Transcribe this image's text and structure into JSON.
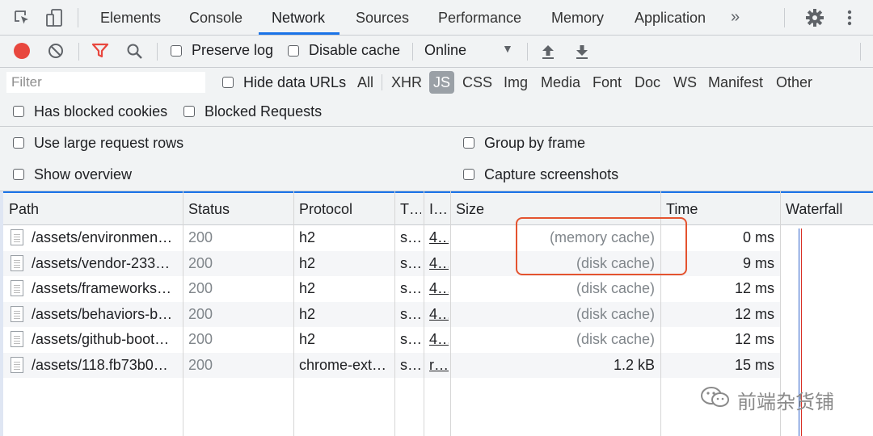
{
  "tabs": [
    "Elements",
    "Console",
    "Network",
    "Sources",
    "Performance",
    "Memory",
    "Application"
  ],
  "active_tab": "Network",
  "toolbar": {
    "preserve_log": "Preserve log",
    "disable_cache": "Disable cache",
    "throttle": "Online",
    "colors": {
      "record": "#e8473e",
      "filter": "#e8473e"
    }
  },
  "filter": {
    "placeholder": "Filter",
    "hide_data_urls": "Hide data URLs",
    "types": [
      "All",
      "XHR",
      "JS",
      "CSS",
      "Img",
      "Media",
      "Font",
      "Doc",
      "WS",
      "Manifest",
      "Other"
    ],
    "active_type": "JS",
    "has_blocked_cookies": "Has blocked cookies",
    "blocked_requests": "Blocked Requests"
  },
  "settings": {
    "large_rows": "Use large request rows",
    "group_by_frame": "Group by frame",
    "show_overview": "Show overview",
    "capture_screenshots": "Capture screenshots"
  },
  "columns": [
    "Path",
    "Status",
    "Protocol",
    "T…",
    "I…",
    "Size",
    "Time",
    "Waterfall"
  ],
  "rows": [
    {
      "path": "/assets/environmen…",
      "status": "200",
      "protocol": "h2",
      "type": "s…",
      "initiator": "4…",
      "size": "(memory cache)",
      "time": "0 ms"
    },
    {
      "path": "/assets/vendor-233…",
      "status": "200",
      "protocol": "h2",
      "type": "s…",
      "initiator": "4…",
      "size": "(disk cache)",
      "time": "9 ms"
    },
    {
      "path": "/assets/frameworks…",
      "status": "200",
      "protocol": "h2",
      "type": "s…",
      "initiator": "4…",
      "size": "(disk cache)",
      "time": "12 ms"
    },
    {
      "path": "/assets/behaviors-b…",
      "status": "200",
      "protocol": "h2",
      "type": "s…",
      "initiator": "4…",
      "size": "(disk cache)",
      "time": "12 ms"
    },
    {
      "path": "/assets/github-boot…",
      "status": "200",
      "protocol": "h2",
      "type": "s…",
      "initiator": "4…",
      "size": "(disk cache)",
      "time": "12 ms"
    },
    {
      "path": "/assets/118.fb73b0…",
      "status": "200",
      "protocol": "chrome-ext…",
      "type": "s…",
      "initiator": "r…",
      "size": "1.2 kB",
      "time": "15 ms"
    }
  ],
  "watermark": "前端杂货铺",
  "highlight_color": "#e4532f"
}
